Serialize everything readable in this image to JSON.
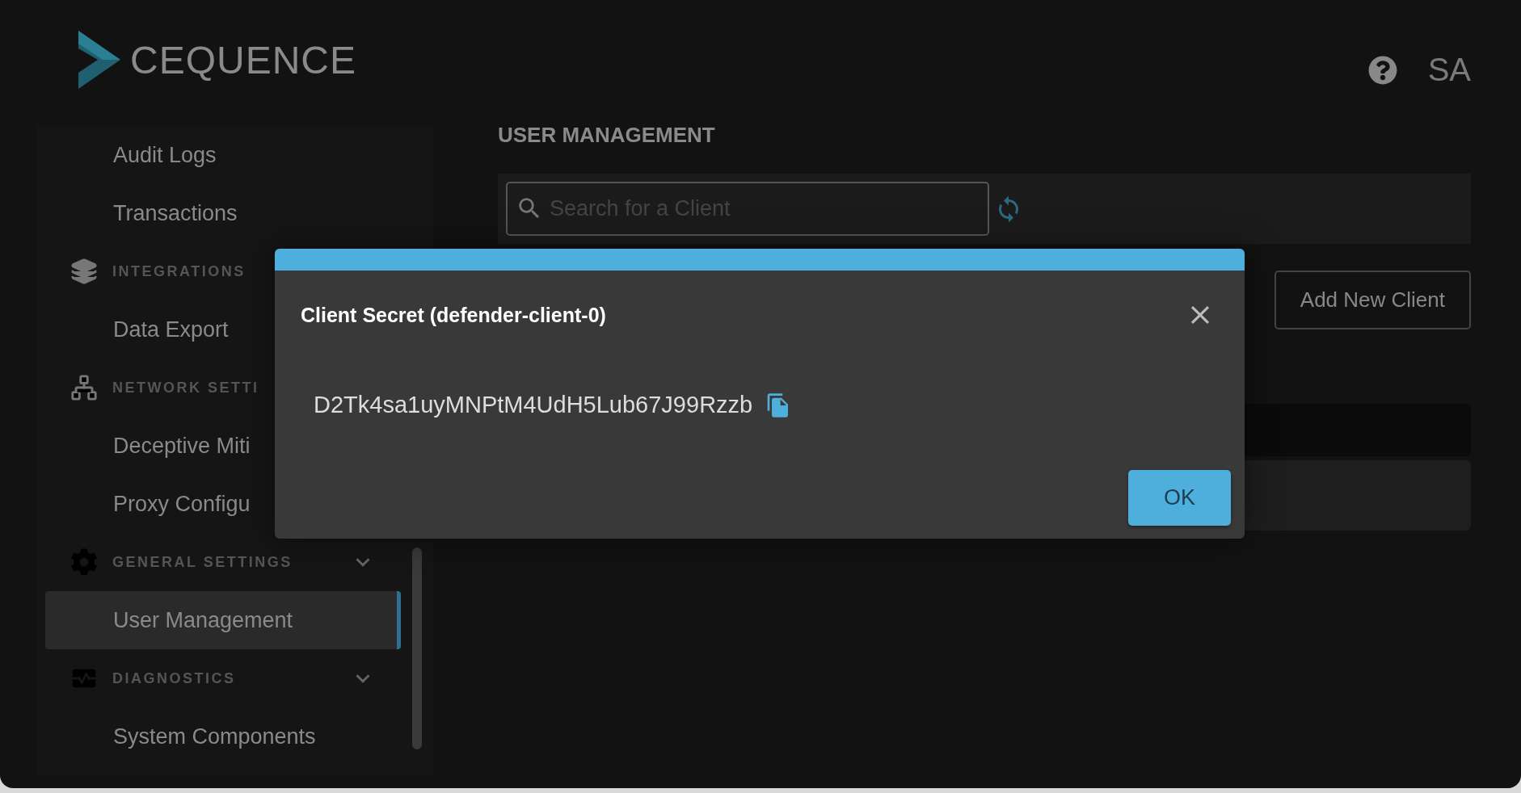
{
  "header": {
    "logo_text": "CEQUENCE",
    "user_initials": "SA"
  },
  "sidebar": {
    "groups": [
      {
        "items": [
          {
            "label": "Audit Logs",
            "selected": false
          },
          {
            "label": "Transactions",
            "selected": false
          }
        ]
      },
      {
        "title": "INTEGRATIONS",
        "items": [
          {
            "label": "Data Export",
            "selected": false
          }
        ]
      },
      {
        "title": "NETWORK SETTI",
        "items": [
          {
            "label": "Deceptive Miti",
            "selected": false
          },
          {
            "label": "Proxy Configu",
            "selected": false
          }
        ]
      },
      {
        "title": "GENERAL SETTINGS",
        "expanded": true,
        "items": [
          {
            "label": "User Management",
            "selected": true
          }
        ]
      },
      {
        "title": "DIAGNOSTICS",
        "expanded": true,
        "items": [
          {
            "label": "System Components",
            "selected": false
          }
        ]
      }
    ]
  },
  "main": {
    "title": "USER MANAGEMENT",
    "search": {
      "placeholder": "Search for a Client"
    },
    "add_button": "Add New Client"
  },
  "dialog": {
    "title": "Client Secret (defender-client-0)",
    "secret": "D2Tk4sa1uyMNPtM4UdH5Lub67J99Rzzb",
    "ok_button": "OK"
  }
}
